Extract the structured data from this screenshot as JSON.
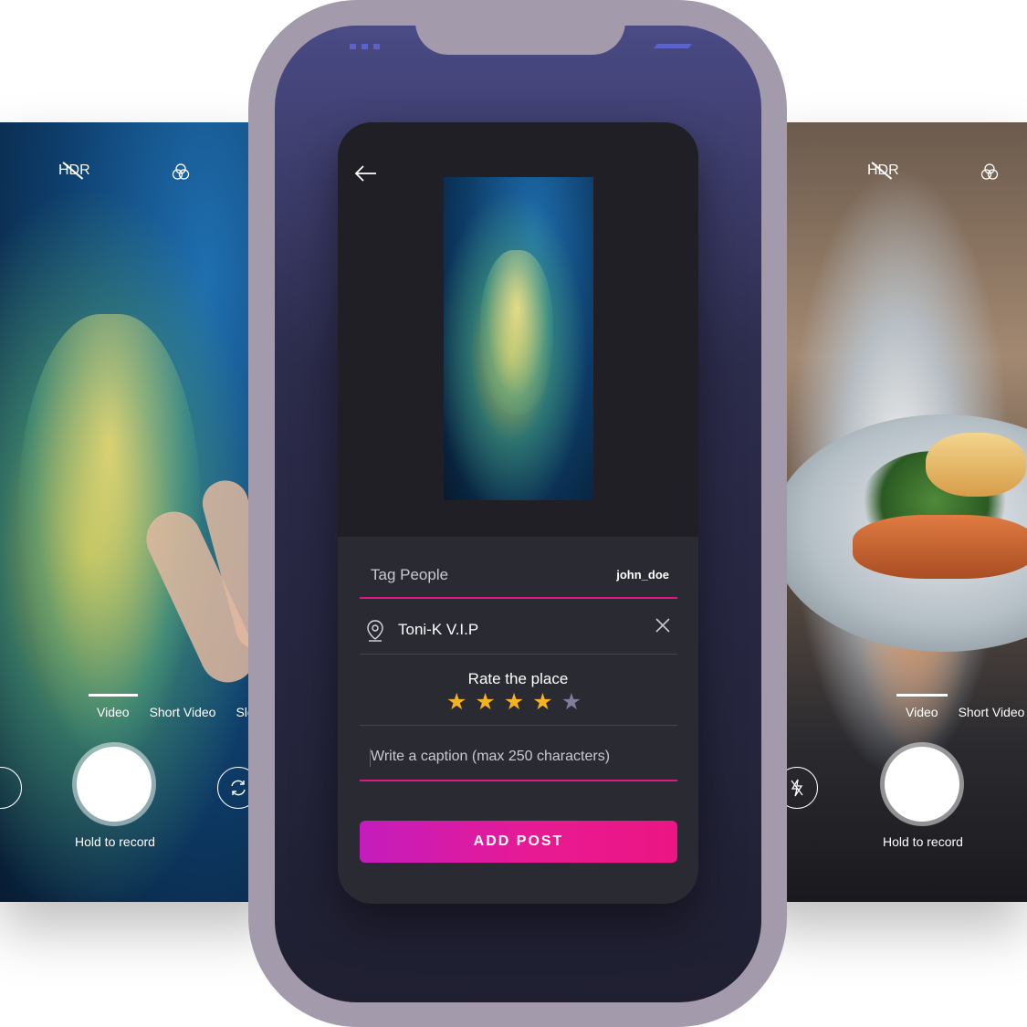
{
  "colors": {
    "accent": "#e5187f",
    "button_gradient_start": "#c41cbd",
    "button_gradient_end": "#ec1583",
    "card_background": "#1f1f25",
    "phone_frame": "#a39aab",
    "star_active": "#f5b323",
    "star_inactive": "#7d7f9a"
  },
  "left_camera": {
    "hdr_label": "HDR",
    "filter_icon": "filters-icon",
    "menu_icon": "menu-icon",
    "modes": [
      "Video",
      "Short Video",
      "Slow Motio"
    ],
    "active_mode": "Video",
    "hold_label": "Hold to record",
    "flip_icon": "camera-flip-icon"
  },
  "right_camera": {
    "close_icon": "close-icon",
    "hdr_label": "HDR",
    "filter_icon": "filters-icon",
    "modes": [
      "Video",
      "Short Video"
    ],
    "active_mode": "Video",
    "hold_label": "Hold to record",
    "flash_icon": "flash-off-icon"
  },
  "post_form": {
    "back_icon": "back-arrow-icon",
    "tag_people_label": "Tag People",
    "tag_people_value": "john_doe",
    "location_icon": "location-pin-icon",
    "location_value": "Toni-K V.I.P",
    "rate_label": "Rate the place",
    "rating": 4,
    "rating_max": 5,
    "caption_placeholder": "Write a caption (max 250 characters)",
    "submit_label": "ADD POST"
  }
}
